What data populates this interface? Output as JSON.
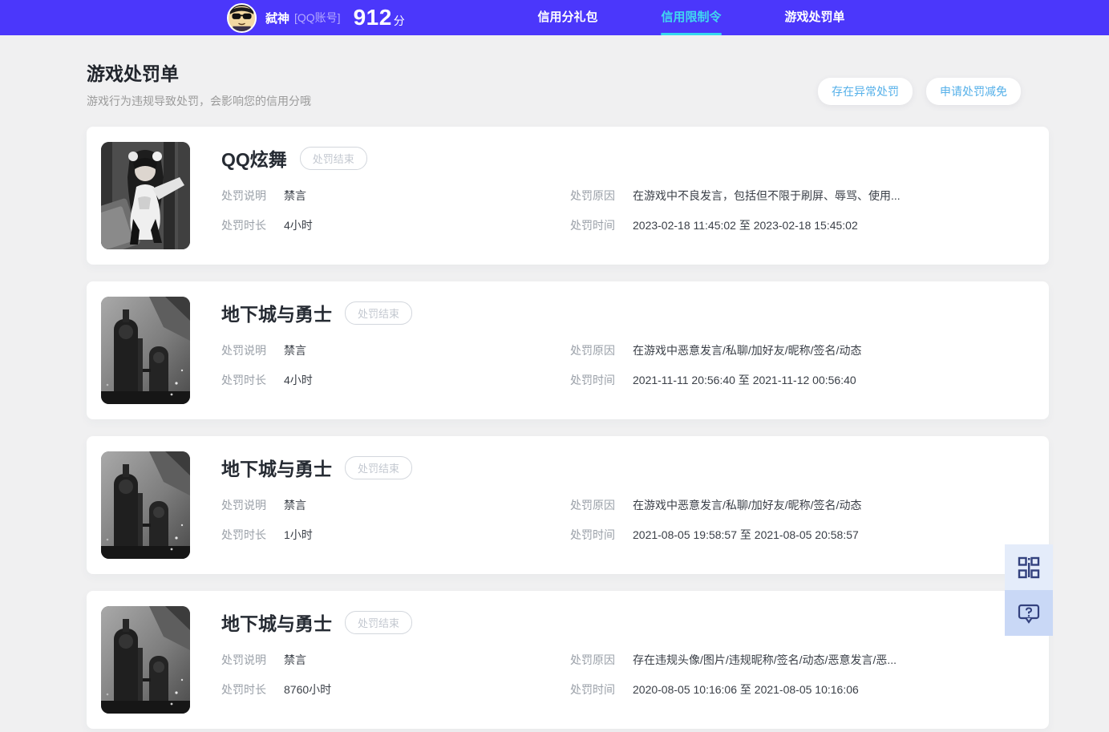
{
  "header": {
    "user": {
      "name": "弑神",
      "account_type": "[QQ账号]",
      "score": "912",
      "score_unit": "分",
      "avatar_icon": "cartoon-avatar"
    },
    "tabs": [
      {
        "label": "信用分礼包",
        "active": false
      },
      {
        "label": "信用限制令",
        "active": true
      },
      {
        "label": "游戏处罚单",
        "active": false
      }
    ]
  },
  "page": {
    "title": "游戏处罚单",
    "subtitle": "游戏行为违规导致处罚，会影响您的信用分哦",
    "actions": [
      {
        "label": "存在异常处罚"
      },
      {
        "label": "申请处罚减免"
      }
    ]
  },
  "field_labels": {
    "desc": "处罚说明",
    "duration": "处罚时长",
    "reason": "处罚原因",
    "time": "处罚时间"
  },
  "cards": [
    {
      "game": "QQ炫舞",
      "status": "处罚结束",
      "desc": "禁言",
      "duration": "4小时",
      "reason": "在游戏中不良发言，包括但不限于刷屏、辱骂、使用...",
      "time": "2023-02-18 11:45:02 至 2023-02-18 15:45:02",
      "thumb": "qq-dance-grayscale-art"
    },
    {
      "game": "地下城与勇士",
      "status": "处罚结束",
      "desc": "禁言",
      "duration": "4小时",
      "reason": "在游戏中恶意发言/私聊/加好友/昵称/签名/动态",
      "time": "2021-11-11 20:56:40 至 2021-11-12 00:56:40",
      "thumb": "dnf-grayscale-art"
    },
    {
      "game": "地下城与勇士",
      "status": "处罚结束",
      "desc": "禁言",
      "duration": "1小时",
      "reason": "在游戏中恶意发言/私聊/加好友/昵称/签名/动态",
      "time": "2021-08-05 19:58:57 至 2021-08-05 20:58:57",
      "thumb": "dnf-grayscale-art"
    },
    {
      "game": "地下城与勇士",
      "status": "处罚结束",
      "desc": "禁言",
      "duration": "8760小时",
      "reason": "存在违规头像/图片/违规昵称/签名/动态/恶意发言/恶...",
      "time": "2020-08-05 10:16:06 至 2021-08-05 10:16:06",
      "thumb": "dnf-grayscale-art"
    }
  ],
  "floating_buttons": [
    {
      "icon": "qr-code-icon"
    },
    {
      "icon": "help-question-icon"
    }
  ],
  "colors": {
    "header_bg": "#4b37fb",
    "active_tab": "#35d8ee",
    "action_link": "#55b0e9",
    "page_bg": "#f0f0f1",
    "badge_gray": "#c3c8d0",
    "fab_icon": "#33417e"
  }
}
